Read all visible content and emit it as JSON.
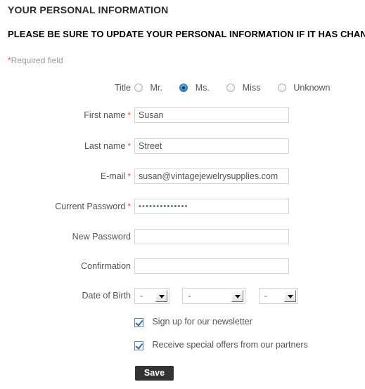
{
  "header": {
    "title": "YOUR PERSONAL INFORMATION",
    "subtitle": "PLEASE BE SURE TO UPDATE YOUR PERSONAL INFORMATION IF IT HAS CHANGED.",
    "required_star": "*",
    "required_note": "Required field"
  },
  "colors": {
    "required_star": "#e4572e",
    "label_text": "#555454",
    "button_background": "#333333",
    "radio_selected": "#2f8fd6",
    "checkbox_check": "#2f6fb5"
  },
  "form": {
    "title_row": {
      "label": "Title",
      "options": [
        {
          "label": "Mr.",
          "selected": false
        },
        {
          "label": "Ms.",
          "selected": true
        },
        {
          "label": "Miss",
          "selected": false
        },
        {
          "label": "Unknown",
          "selected": false
        }
      ]
    },
    "first_name": {
      "label": "First name",
      "required": "*",
      "value": "Susan",
      "placeholder": ""
    },
    "last_name": {
      "label": "Last name",
      "required": "*",
      "value": "Street",
      "placeholder": ""
    },
    "email": {
      "label": "E-mail",
      "required": "*",
      "value": "susan@vintagejewelrysupplies.com",
      "placeholder": ""
    },
    "current_password": {
      "label": "Current Password",
      "required": "*",
      "value": "••••••••••••••",
      "placeholder": ""
    },
    "new_password": {
      "label": "New Password",
      "value": "",
      "placeholder": ""
    },
    "confirmation": {
      "label": "Confirmation",
      "value": "",
      "placeholder": ""
    },
    "date_of_birth": {
      "label": "Date of Birth",
      "day": "-",
      "month": "-",
      "year": "-"
    },
    "newsletter": {
      "label": "Sign up for our newsletter",
      "checked": true
    },
    "partner_offers": {
      "label": "Receive special offers from our partners",
      "checked": true
    },
    "save_button": {
      "label": "Save"
    }
  }
}
